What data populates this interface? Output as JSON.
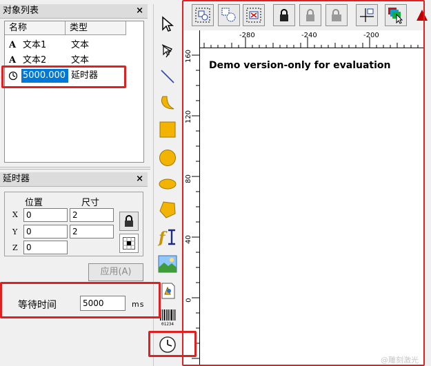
{
  "object_panel": {
    "title": "对象列表",
    "close": "×",
    "columns": [
      "名称",
      "类型"
    ],
    "rows": [
      {
        "icon": "A",
        "name": "文本1",
        "type": "文本"
      },
      {
        "icon": "A",
        "name": "文本2",
        "type": "文本"
      },
      {
        "icon": "timer-icon",
        "name": "5000.000",
        "type": "延时器"
      }
    ]
  },
  "timer_panel": {
    "title": "延时器",
    "close": "×",
    "position_label": "位置",
    "size_label": "尺寸",
    "axis_labels": [
      "X",
      "Y",
      "Z"
    ],
    "x": "0",
    "y": "0",
    "z": "0",
    "width": "2",
    "height": "2",
    "apply_label": "应用(A)",
    "wait_label": "等待时间",
    "wait_value": "5000",
    "wait_unit": "ms"
  },
  "canvas": {
    "demo_text": "Demo version-only for evaluation",
    "ruler_top": [
      "-280",
      "-240",
      "-200"
    ],
    "ruler_left": [
      "160",
      "120",
      "80",
      "40",
      "0"
    ]
  },
  "colors": {
    "highlight": "#e02020",
    "selection": "#0078d7"
  },
  "watermark": "@雕刻激光"
}
